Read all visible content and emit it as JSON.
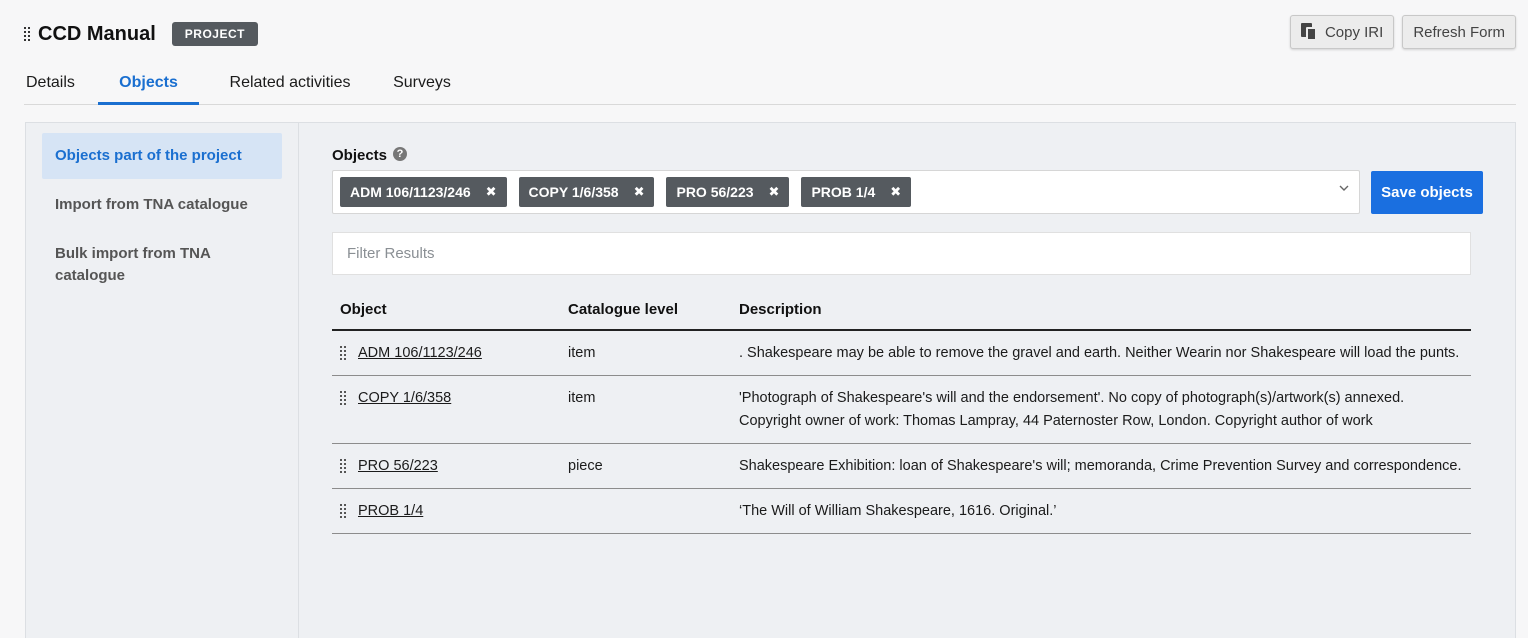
{
  "header": {
    "title": "CCD Manual",
    "badge": "PROJECT",
    "copy_iri_label": "Copy IRI",
    "refresh_form_label": "Refresh Form"
  },
  "tabs": [
    {
      "label": "Details",
      "active": false
    },
    {
      "label": "Objects",
      "active": true
    },
    {
      "label": "Related activities",
      "active": false
    },
    {
      "label": "Surveys",
      "active": false
    }
  ],
  "sidenav": {
    "items": [
      {
        "label": "Objects part of the project",
        "active": true
      },
      {
        "label": "Import from TNA catalogue",
        "active": false
      },
      {
        "label": "Bulk import from TNA catalogue",
        "active": false
      }
    ]
  },
  "objects_field": {
    "label": "Objects",
    "help_icon": "?",
    "chips": [
      "ADM 106/1123/246",
      "COPY 1/6/358",
      "PRO 56/223",
      "PROB 1/4"
    ],
    "remove_icon": "✖",
    "save_label": "Save objects"
  },
  "filter": {
    "placeholder": "Filter Results",
    "value": ""
  },
  "table": {
    "headers": {
      "object": "Object",
      "level": "Catalogue level",
      "description": "Description"
    },
    "rows": [
      {
        "object": "ADM 106/1123/246",
        "level": "item",
        "description": ". Shakespeare may be able to remove the gravel and earth. Neither Wearin nor Shakespeare will load the punts."
      },
      {
        "object": "COPY 1/6/358",
        "level": "item",
        "description": "'Photograph of Shakespeare's will and the endorsement'. No copy of photograph(s)/artwork(s) annexed. Copyright owner of work: Thomas Lampray, 44 Paternoster Row, London. Copyright author of work"
      },
      {
        "object": "PRO 56/223",
        "level": "piece",
        "description": "Shakespeare Exhibition: loan of Shakespeare's will; memoranda, Crime Prevention Survey and correspondence."
      },
      {
        "object": "PROB 1/4",
        "level": "",
        "description": "‘The Will of William Shakespeare, 1616. Original.’"
      }
    ]
  },
  "colors": {
    "accent": "#1a6fe0",
    "chip_bg": "#555a5f",
    "panel_bg": "#eef0f3",
    "nav_active_bg": "#d6e4f5"
  }
}
